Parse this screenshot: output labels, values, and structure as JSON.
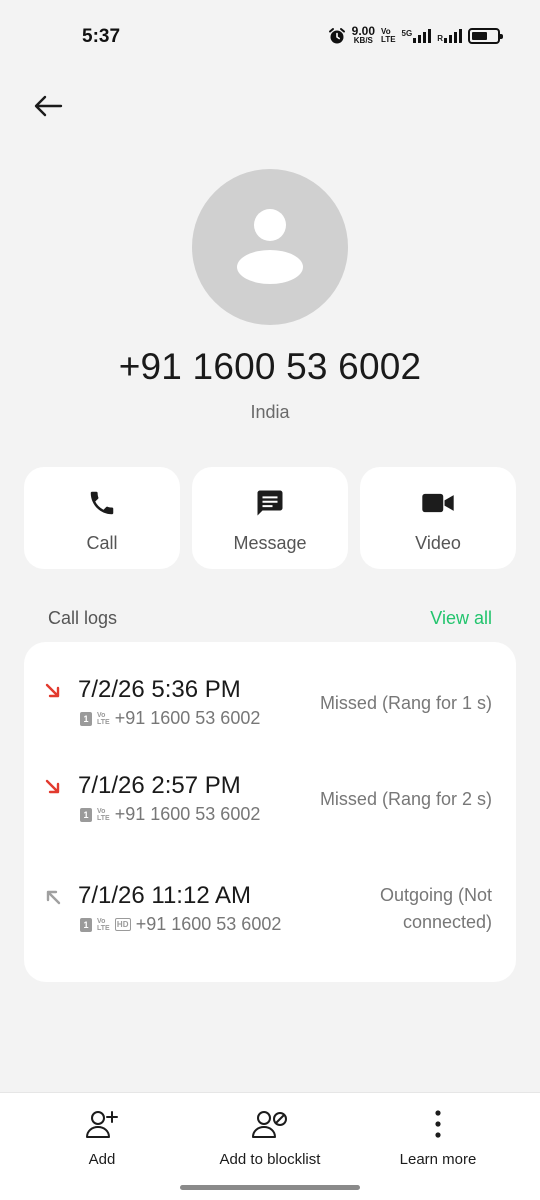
{
  "status_bar": {
    "time": "5:37",
    "speed_value": "9.00",
    "speed_unit": "KB/S",
    "volte_top": "Vo",
    "volte_bottom": "LTE",
    "net": "5G",
    "sim2_r": "R"
  },
  "contact": {
    "number": "+91 1600 53 6002",
    "country": "India"
  },
  "actions": {
    "call": "Call",
    "message": "Message",
    "video": "Video"
  },
  "call_logs": {
    "title": "Call logs",
    "view_all": "View all",
    "entries": [
      {
        "datetime": "7/2/26 5:36 PM",
        "sim": "1",
        "volte_top": "Vo",
        "volte_bottom": "LTE",
        "number": "+91 1600 53 6002",
        "status": "Missed (Rang for 1 s)",
        "type": "missed"
      },
      {
        "datetime": "7/1/26 2:57 PM",
        "sim": "1",
        "volte_top": "Vo",
        "volte_bottom": "LTE",
        "number": "+91 1600 53 6002",
        "status": "Missed (Rang for 2 s)",
        "type": "missed"
      },
      {
        "datetime": "7/1/26 11:12 AM",
        "sim": "1",
        "volte_top": "Vo",
        "volte_bottom": "LTE",
        "hd": "HD",
        "number": "+91 1600 53 6002",
        "status_line1": "Outgoing (Not",
        "status_line2": "connected)",
        "type": "outgoing"
      }
    ]
  },
  "bottom_bar": {
    "add": "Add",
    "blocklist": "Add to blocklist",
    "learn_more": "Learn more"
  },
  "colors": {
    "accent": "#22c46d",
    "missed": "#e23a2e",
    "outgoing": "#a0a0a0",
    "background": "#f3f3f3",
    "card": "#ffffff",
    "avatar": "#d0d0d0"
  },
  "icons": [
    "alarm-icon",
    "back-arrow-icon",
    "person-icon",
    "phone-icon",
    "message-icon",
    "video-icon",
    "missed-call-icon",
    "outgoing-call-icon",
    "add-person-icon",
    "block-person-icon",
    "more-vertical-icon"
  ]
}
